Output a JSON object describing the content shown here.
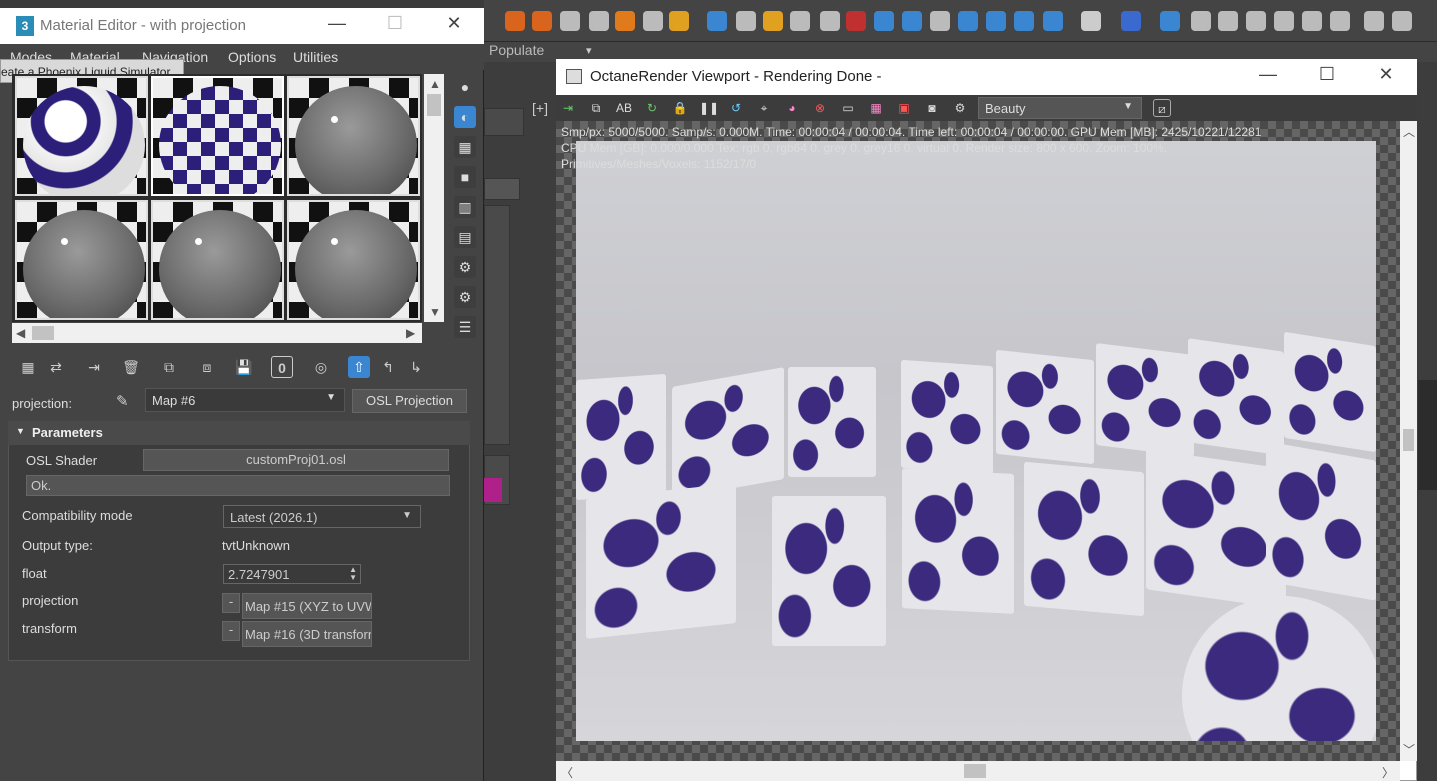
{
  "material_editor": {
    "title": "Material Editor - with projection",
    "logo": "3",
    "menu": [
      "Modes",
      "Material",
      "Navigation",
      "Options",
      "Utilities"
    ],
    "tooltip": "eate a Phoenix Liquid Simulator",
    "projection_label": "projection:",
    "map_dropdown": "Map #6",
    "osl_button": "OSL Projection",
    "params_title": "Parameters",
    "osl_shader_label": "OSL Shader",
    "osl_shader_value": "customProj01.osl",
    "status": "Ok.",
    "compat_label": "Compatibility mode",
    "compat_value": "Latest (2026.1)",
    "output_label": "Output type:",
    "output_value": "tvtUnknown",
    "float_label": "float",
    "float_value": "2.7247901",
    "projection_param_label": "projection",
    "projection_map": "Map #15 (XYZ to UVW",
    "transform_label": "transform",
    "transform_map": "Map #16 (3D transforr",
    "zero_button": "0"
  },
  "background": {
    "populate": "Populate",
    "viewport_label": "[+]"
  },
  "octane": {
    "title": "OctaneRender Viewport - Rendering Done -",
    "channel": "Beauty",
    "info_line1": "Smp/px: 5000/5000.  Samp/s: 0.000M.  Time: 00:00:04 / 00:00:04.  Time left: 00:00:04 / 00:00:00.  GPU Mem [MB]: 2425/10221/12281",
    "info_line2": "CPU Mem [GB]: 0.000/0.000  Tex: rgb 0, rgb64 0, grey 0, grey16 0, virtual 0.  Render size: 800 x 600.  Zoom: 100%.",
    "info_line3": "Primitives/Meshes/Voxels: 1152/17/0",
    "ab_label": "AB"
  }
}
